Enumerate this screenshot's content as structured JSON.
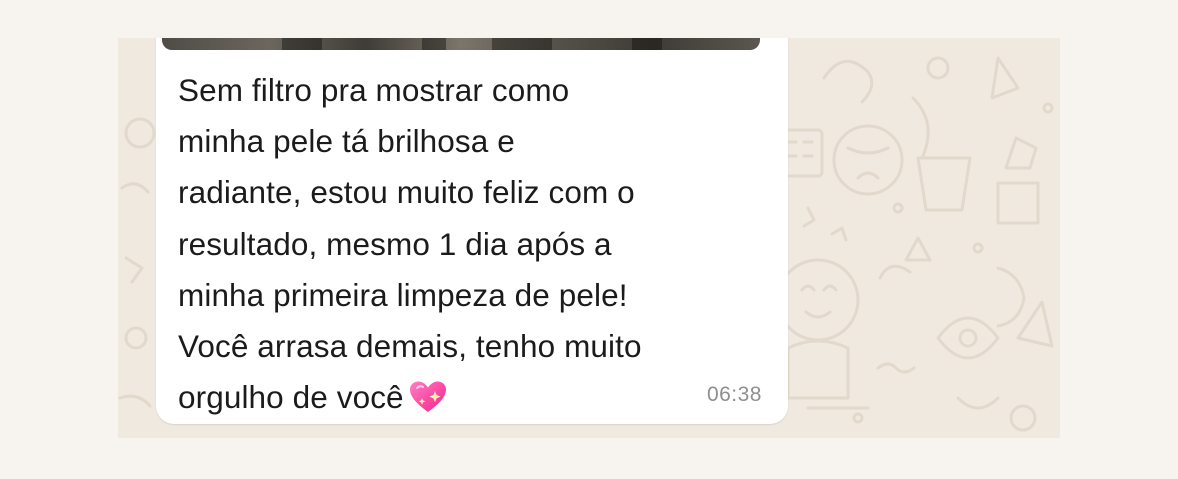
{
  "message": {
    "text": "Sem filtro pra mostrar como\nminha pele tá brilhosa e\nradiante, estou muito feliz com o\nresultado, mesmo 1 dia após a\nminha primeira limpeza de pele!\nVocê arrasa demais, tenho muito\norgulho de você",
    "emoji": "sparkling-heart-icon",
    "time": "06:38"
  },
  "colors": {
    "page_background": "#f7f4f0",
    "chat_wallpaper": "#efe9e0",
    "bubble": "#ffffff",
    "text": "#1b1b1b",
    "timestamp": "#8f8f8f",
    "heart": "#ff3aa0"
  }
}
